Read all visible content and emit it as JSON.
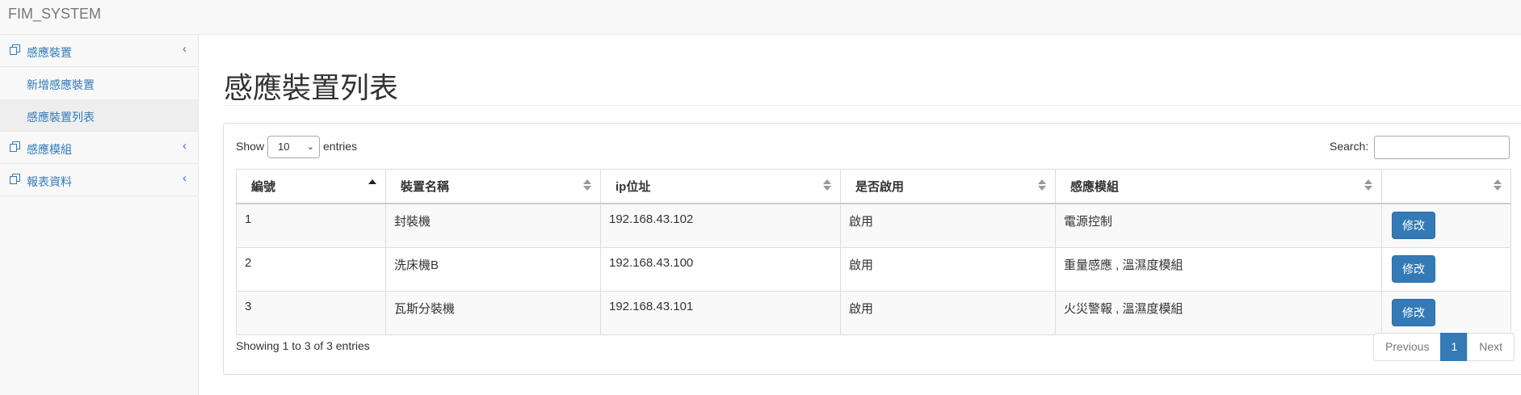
{
  "app": {
    "brand": "FIM_SYSTEM"
  },
  "sidebar": {
    "items": [
      {
        "label": "感應裝置",
        "icon": "copy-icon",
        "expanded": true,
        "children": [
          {
            "label": "新增感應裝置"
          },
          {
            "label": "感應裝置列表",
            "active": true
          }
        ]
      },
      {
        "label": "感應模組",
        "icon": "copy-icon"
      },
      {
        "label": "報表資料",
        "icon": "copy-icon"
      }
    ]
  },
  "page": {
    "title": "感應裝置列表"
  },
  "table_controls": {
    "show_label": "Show",
    "entries_value": "10",
    "entries_label": "entries",
    "search_label": "Search:",
    "search_value": ""
  },
  "table": {
    "columns": [
      "編號",
      "裝置名稱",
      "ip位址",
      "是否啟用",
      "感應模組",
      ""
    ],
    "rows": [
      [
        "1",
        "封裝機",
        "192.168.43.102",
        "啟用",
        "電源控制",
        "修改"
      ],
      [
        "2",
        "洗床機B",
        "192.168.43.100",
        "啟用",
        "重量感應 , 溫濕度模組",
        "修改"
      ],
      [
        "3",
        "瓦斯分裝機",
        "192.168.43.101",
        "啟用",
        "火災警報 , 溫濕度模組",
        "修改"
      ]
    ]
  },
  "footer": {
    "info": "Showing 1 to 3 of 3 entries",
    "pagination": {
      "previous": "Previous",
      "current": "1",
      "next": "Next"
    }
  },
  "colors": {
    "accent": "#337ab7",
    "sidebar_bg": "#f8f8f8",
    "stripe": "#f9f9f9"
  }
}
